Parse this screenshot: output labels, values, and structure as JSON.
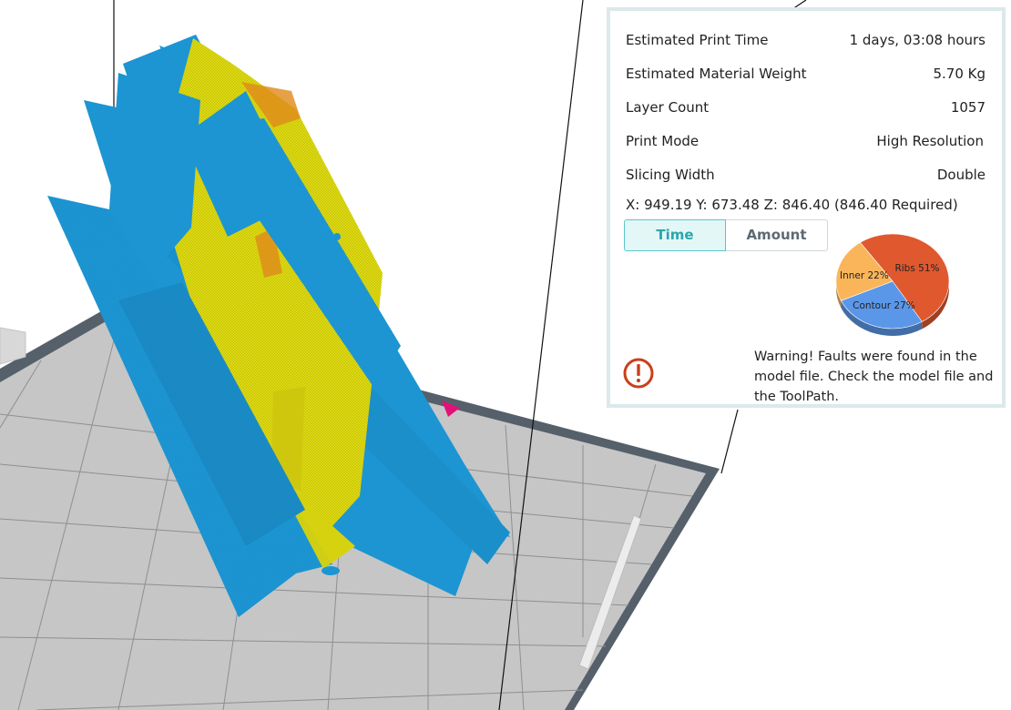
{
  "stats": [
    {
      "label": "Estimated Print Time",
      "value": "1 days, 03:08 hours"
    },
    {
      "label": "Estimated Material Weight",
      "value": "5.70 Kg"
    },
    {
      "label": "Layer Count",
      "value": "1057"
    },
    {
      "label": "Print Mode",
      "value": "High Resolution"
    },
    {
      "label": "Slicing Width",
      "value": "Double"
    }
  ],
  "coordinates": "X: 949.19  Y: 673.48  Z: 846.40 (846.40 Required)",
  "tabs": {
    "time": "Time",
    "amount": "Amount",
    "active": "Time"
  },
  "warning": {
    "icon": "exclamation-circle-icon",
    "color": "#c9401c",
    "text": "Warning! Faults were found in the model file.  Check the model file and the ToolPath."
  },
  "chart_data": {
    "type": "pie",
    "title": "",
    "series": [
      {
        "name": "Ribs",
        "value": 51,
        "label": "Ribs 51%",
        "color": "#e0582e"
      },
      {
        "name": "Contour",
        "value": 27,
        "label": "Contour 27%",
        "color": "#5b97e8"
      },
      {
        "name": "Inner",
        "value": 22,
        "label": "Inner 22%",
        "color": "#fab55a"
      }
    ],
    "style": "3d"
  },
  "colors": {
    "accent": "#2aa7ad",
    "panel_border": "#dbe9eb",
    "model_blue": "#1c95d2",
    "model_yellow": "#dedb11",
    "bed_gray": "#c4c4c4",
    "bed_border": "#55606a"
  }
}
